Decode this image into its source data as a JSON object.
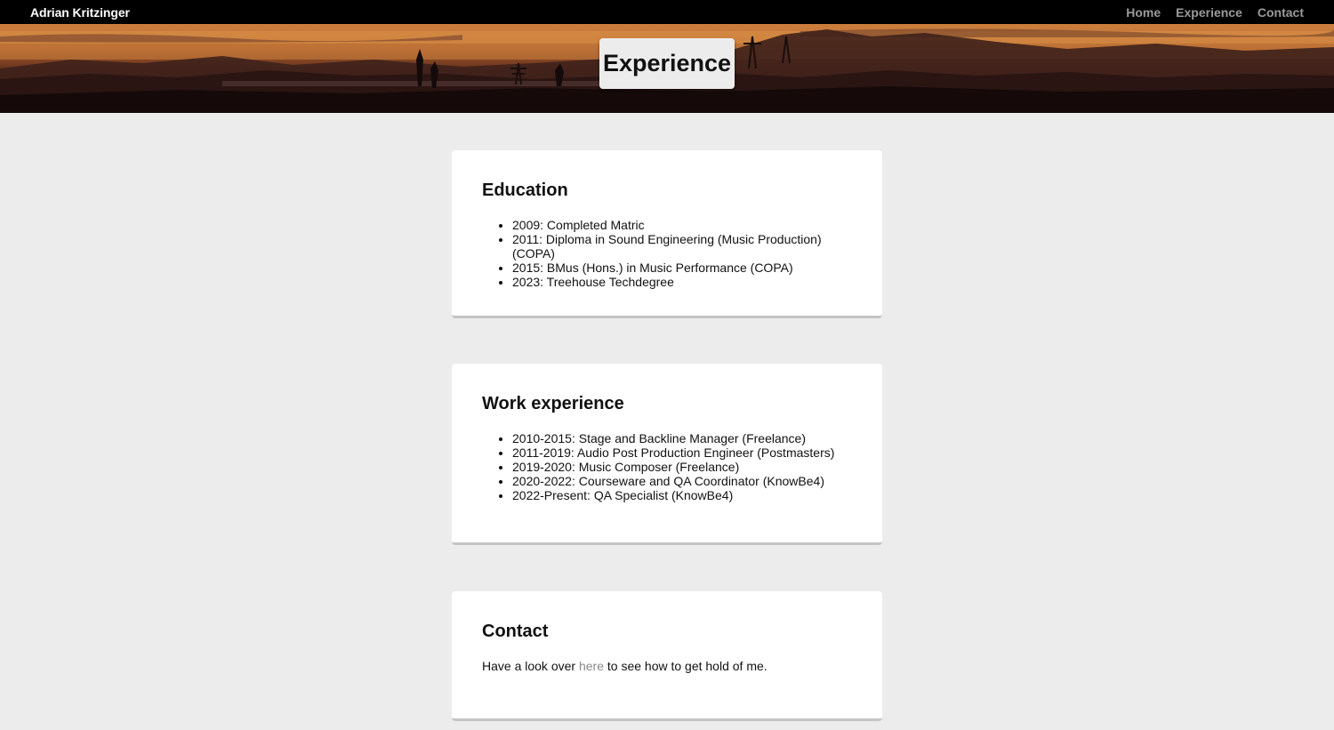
{
  "site": {
    "brand": "Adrian Kritzinger",
    "nav": [
      "Home",
      "Experience",
      "Contact"
    ]
  },
  "hero": {
    "title": "Experience"
  },
  "education": {
    "heading": "Education",
    "items": [
      "2009: Completed Matric",
      "2011: Diploma in Sound Engineering (Music Production) (COPA)",
      "2015: BMus (Hons.) in Music Performance (COPA)",
      "2023: Treehouse Techdegree"
    ]
  },
  "work": {
    "heading": "Work experience",
    "items": [
      "2010-2015: Stage and Backline Manager (Freelance)",
      "2011-2019: Audio Post Production Engineer (Postmasters)",
      "2019-2020: Music Composer (Freelance)",
      "2020-2022: Courseware and QA Coordinator (KnowBe4)",
      "2022-Present: QA Specialist (KnowBe4)"
    ]
  },
  "contact": {
    "heading": "Contact",
    "text_before": "Have a look over ",
    "link_label": "here",
    "text_after": " to see how to get hold of me."
  }
}
